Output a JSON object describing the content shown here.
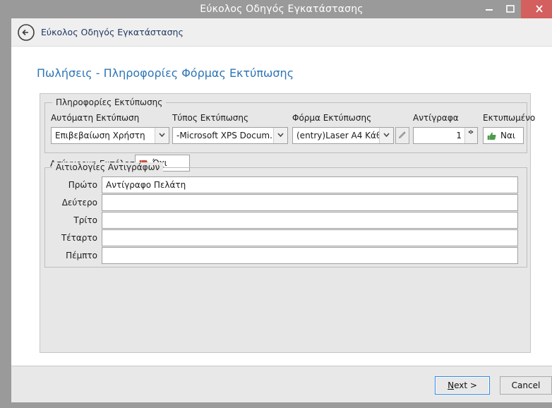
{
  "window": {
    "title": "Εύκολος Οδηγός Εγκατάστασης",
    "minimize_label": "minimize",
    "maximize_label": "maximize",
    "close_label": "close",
    "accent_close_color": "#d35f5f",
    "frame_color": "#9a9a9a"
  },
  "navbar": {
    "back_label": "back",
    "title": "Εύκολος Οδηγός Εγκατάστασης",
    "title_color": "#1f3864"
  },
  "page": {
    "title": "Πωλήσεις - Πληροφορίες Φόρμας Εκτύπωσης",
    "title_color": "#2e75b6"
  },
  "print_group": {
    "legend": "Πληροφορίες  Εκτύπωσης",
    "fields": [
      {
        "label": "Αυτόματη Εκτύπωση",
        "value": "Επιβεβαίωση Χρήστη",
        "control": "combobox"
      },
      {
        "label": "Τύπος Εκτύπωσης",
        "value": "-Microsoft XPS Docum...",
        "control": "combobox"
      },
      {
        "label": "Φόρμα Εκτύπωσης",
        "value": "(entry)Laser A4 Κάθ...",
        "control": "combobox",
        "side_button_icon": "pencil-icon"
      },
      {
        "label": "Αντίγραφα",
        "value": "1",
        "control": "spinner"
      },
      {
        "label": "Εκτυπωμένο",
        "value": "Ναι",
        "control": "flag",
        "flag_icon": "thumbs-up-icon",
        "flag_color": "#4d9b4d"
      }
    ],
    "async": {
      "label": "Ασύγχρονη Εκτέλεση",
      "value": "Όχι",
      "flag_icon": "thumbs-down-icon",
      "flag_color": "#cc4d3d"
    }
  },
  "reasons_group": {
    "legend": "Αιτιολογίες Αντιγράφων",
    "rows": [
      {
        "label": "Πρώτο",
        "value": "Αντίγραφο Πελάτη"
      },
      {
        "label": "Δεύτερο",
        "value": ""
      },
      {
        "label": "Τρίτο",
        "value": ""
      },
      {
        "label": "Τέταρτο",
        "value": ""
      },
      {
        "label": "Πέμπτο",
        "value": ""
      }
    ]
  },
  "footer": {
    "next_accel": "N",
    "next_rest": "ext >",
    "cancel_label": "Cancel"
  }
}
